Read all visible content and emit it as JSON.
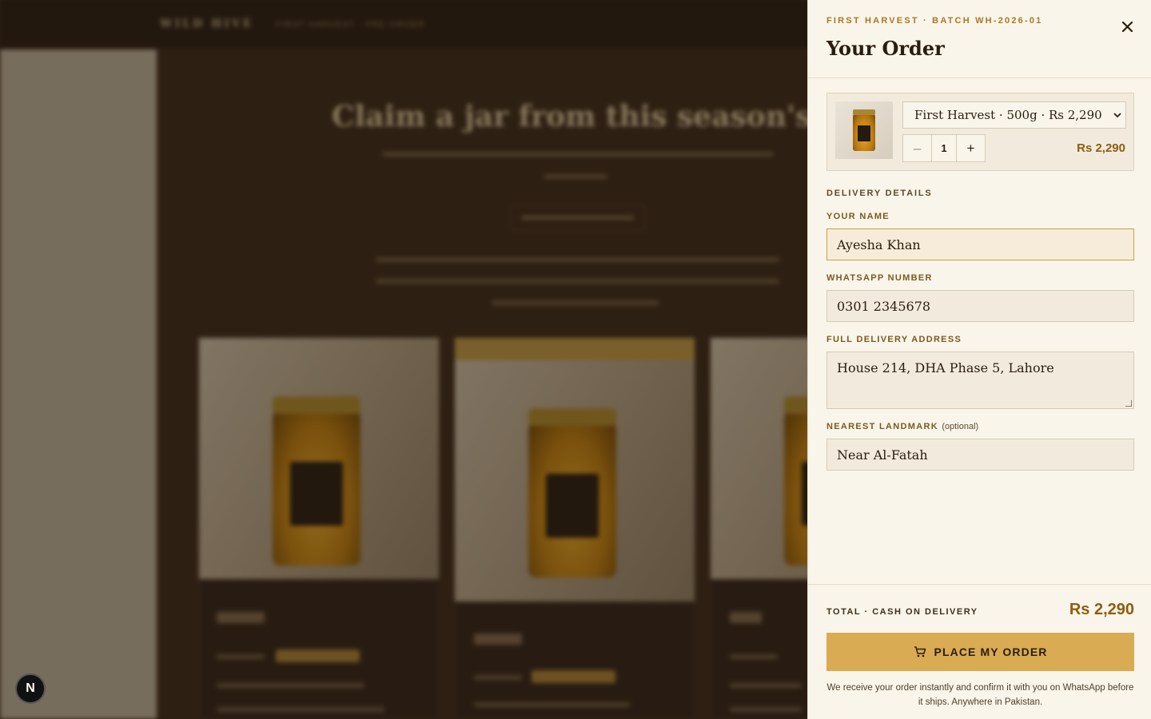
{
  "drawer": {
    "eyebrow": "FIRST HARVEST · BATCH WH-2026-01",
    "title": "Your Order",
    "close_icon": "close-icon"
  },
  "product": {
    "variant_selected": "First Harvest · 500g · Rs 2,290",
    "quantity": "1",
    "decrement_label": "–",
    "increment_label": "+",
    "line_total": "Rs 2,290"
  },
  "delivery": {
    "section_label": "DELIVERY DETAILS",
    "name_label": "YOUR NAME",
    "name_value": "Ayesha Khan",
    "whatsapp_label": "WHATSAPP NUMBER",
    "whatsapp_value": "0301 2345678",
    "address_label": "FULL DELIVERY ADDRESS",
    "address_value": "House 214, DHA Phase 5, Lahore",
    "landmark_label": "NEAREST LANDMARK",
    "landmark_optional": "(optional)",
    "landmark_value": "Near Al-Fatah"
  },
  "footer": {
    "total_label": "TOTAL · CASH ON DELIVERY",
    "total_value": "Rs 2,290",
    "order_button_label": "PLACE MY ORDER",
    "order_button_icon": "cart-icon",
    "note": "We receive your order instantly and confirm it with you on WhatsApp before it ships. Anywhere in Pakistan."
  },
  "badge": {
    "letter": "N"
  },
  "colors": {
    "accent_gold": "#d9ab52",
    "price_brown": "#8d5d12",
    "eyebrow_gold": "#a57a23",
    "drawer_bg": "#faf5ea"
  }
}
